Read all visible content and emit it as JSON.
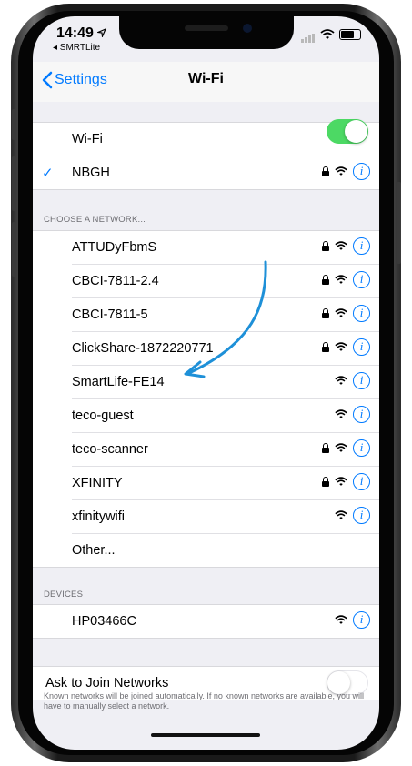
{
  "status_bar": {
    "time": "14:49",
    "back_app": "◂ SMRTLite"
  },
  "navbar": {
    "back_label": "Settings",
    "title": "Wi-Fi"
  },
  "wifi_group": {
    "wifi_label": "Wi-Fi",
    "wifi_enabled": true,
    "connected_network": "NBGH"
  },
  "choose_header": "CHOOSE A NETWORK...",
  "networks": [
    {
      "name": "ATTUDyFbmS",
      "locked": true
    },
    {
      "name": "CBCI-7811-2.4",
      "locked": true
    },
    {
      "name": "CBCI-7811-5",
      "locked": true
    },
    {
      "name": "ClickShare-1872220771",
      "locked": true
    },
    {
      "name": "SmartLife-FE14",
      "locked": false
    },
    {
      "name": "teco-guest",
      "locked": false
    },
    {
      "name": "teco-scanner",
      "locked": true
    },
    {
      "name": "XFINITY",
      "locked": true
    },
    {
      "name": "xfinitywifi",
      "locked": false
    }
  ],
  "other_label": "Other...",
  "devices_header": "DEVICES",
  "devices": [
    {
      "name": "HP03466C",
      "locked": false
    }
  ],
  "ask_to_join": {
    "label": "Ask to Join Networks",
    "enabled": false
  },
  "footer_note": "Known networks will be joined automatically. If no known networks are available, you will have to manually select a network.",
  "colors": {
    "accent": "#007aff",
    "toggle_on": "#4cd964",
    "arrow": "#1e90d8"
  }
}
